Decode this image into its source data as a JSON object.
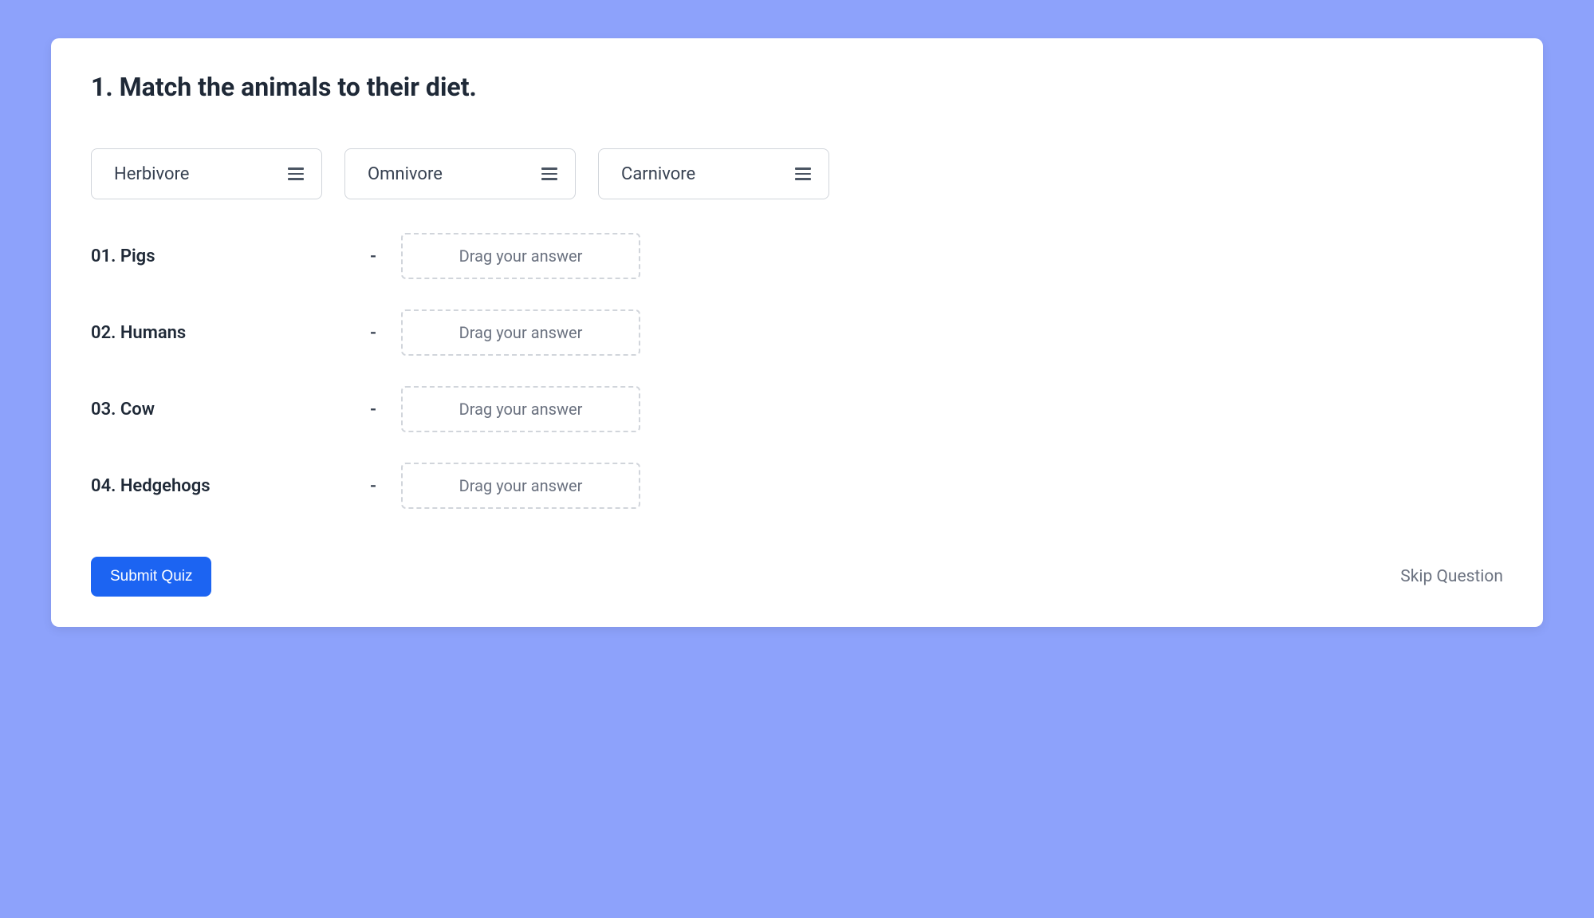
{
  "question": {
    "number": "1.",
    "text": "Match the animals to their diet.",
    "full_title": "1. Match the animals to their diet."
  },
  "choices": [
    {
      "label": "Herbivore"
    },
    {
      "label": "Omnivore"
    },
    {
      "label": "Carnivore"
    }
  ],
  "rows": [
    {
      "label": "01. Pigs",
      "dash": "-",
      "placeholder": "Drag your answer"
    },
    {
      "label": "02. Humans",
      "dash": "-",
      "placeholder": "Drag your answer"
    },
    {
      "label": "03. Cow",
      "dash": "-",
      "placeholder": "Drag your answer"
    },
    {
      "label": "04. Hedgehogs",
      "dash": "-",
      "placeholder": "Drag your answer"
    }
  ],
  "footer": {
    "submit_label": "Submit Quiz",
    "skip_label": "Skip Question"
  },
  "colors": {
    "page_bg": "#8da2fb",
    "card_bg": "#ffffff",
    "primary": "#1c64f2",
    "text": "#1f2937",
    "border": "#d1d5db",
    "muted": "#6b7280"
  }
}
